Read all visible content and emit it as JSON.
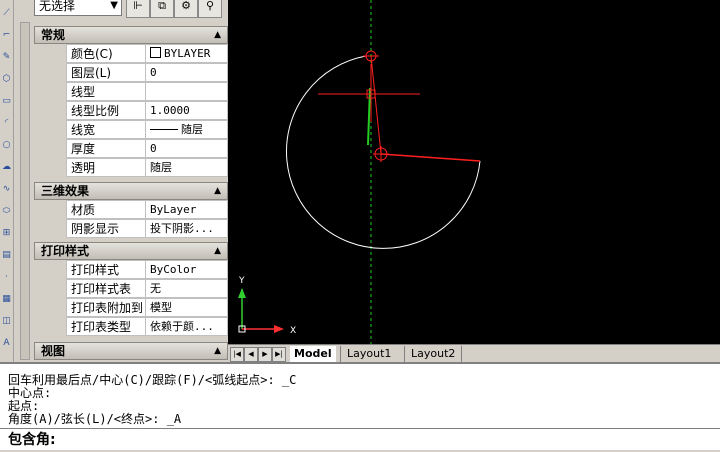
{
  "palette": {
    "selection": "无选择",
    "sections": {
      "general": "常规",
      "3d": "三维效果",
      "plot": "打印样式",
      "view": "视图"
    },
    "general_rows": [
      {
        "name": "颜色(C)",
        "value": "BYLAYER"
      },
      {
        "name": "图层(L)",
        "value": "0"
      },
      {
        "name": "线型",
        "value": ""
      },
      {
        "name": "线型比例",
        "value": "1.0000"
      },
      {
        "name": "线宽",
        "value": "随层"
      },
      {
        "name": "厚度",
        "value": "0"
      },
      {
        "name": "透明",
        "value": "随层"
      }
    ],
    "effect_rows": [
      {
        "name": "材质",
        "value": "ByLayer"
      },
      {
        "name": "阴影显示",
        "value": "投下阴影..."
      }
    ],
    "plot_rows": [
      {
        "name": "打印样式",
        "value": "ByColor"
      },
      {
        "name": "打印样式表",
        "value": "无"
      },
      {
        "name": "打印表附加到",
        "value": "模型"
      },
      {
        "name": "打印表类型",
        "value": "依赖于颜..."
      }
    ]
  },
  "tabs": {
    "model": "Model",
    "layout1": "Layout1",
    "layout2": "Layout2"
  },
  "ucs": {
    "x": "X",
    "y": "Y"
  },
  "command": {
    "history": [
      "回车利用最后点/中心(C)/跟踪(F)/<弧线起点>: _C",
      "中心点:",
      "起点:",
      "角度(A)/弦长(L)/<终点>: _A"
    ],
    "prompt": "包含角:"
  },
  "colors": {
    "canvas_bg": "#000000",
    "arc": "#ffffff",
    "rubber_band": "#ff2020",
    "tracking": "#22cc22",
    "ucs_x": "#ff3030",
    "ucs_y": "#30d030"
  }
}
